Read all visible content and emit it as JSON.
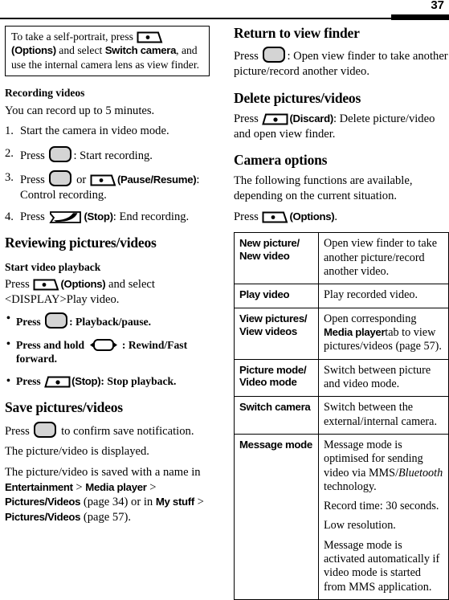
{
  "header": {
    "page_number": "37"
  },
  "left_column": {
    "note_box": {
      "text_1": "To take a self-portrait, press ",
      "key_options_label": "(Options)",
      "text_2": " and select ",
      "term_switch_camera": "Switch camera",
      "text_3": ", and use the internal camera lens as view finder."
    },
    "recording_videos": {
      "heading": "Recording videos",
      "intro": "You can record up to 5 minutes.",
      "steps": [
        {
          "num": "1.",
          "text_before": "Start the camera in video mode.",
          "keys": [],
          "text_after": ""
        },
        {
          "num": "2.",
          "text_before": "Press ",
          "key_center": "select-key",
          "text_after": ": Start recording."
        },
        {
          "num": "3.",
          "text_before": "Press ",
          "mid_text": " or ",
          "key_label": "(Pause/Resume)",
          "text_after": ": Control recording."
        },
        {
          "num": "4.",
          "text_before": "Press ",
          "key_label": "(Stop)",
          "text_after": ": End recording."
        }
      ]
    },
    "reviewing": {
      "heading": "Reviewing pictures/videos",
      "subheading": "Start video playback",
      "press_text": "Press ",
      "options_label": "(Options)",
      "press_text_2": " and select <DISPLAY>Play video.",
      "bullets": [
        {
          "text_before": "Press ",
          "key": "select-key",
          "text_after": ": Playback/pause."
        },
        {
          "text_before": "Press and hold ",
          "key": "nav-key",
          "text_after": " : Rewind/Fast forward."
        },
        {
          "text_before": "Press ",
          "key": "right-soft-key",
          "key_label": "(Stop)",
          "text_after": ": Stop playback."
        }
      ]
    },
    "save": {
      "heading": "Save pictures/videos",
      "line1_before": "Press ",
      "line1_after": " to confirm save notification.",
      "line2": "The picture/video is displayed.",
      "line3_a": "The picture/video is saved with a name in ",
      "line3_term1": "Entertainment",
      "line3_sep1": " > ",
      "line3_term2": "Media player",
      "line3_sep2": " > ",
      "line3_term3": "Pictures/Videos",
      "line3_b": " (page 34)  or in ",
      "line3_term4": "My stuff",
      "line3_sep3": " > ",
      "line3_term5": "Pictures/Videos",
      "line3_c": " (page 57)."
    }
  },
  "right_column": {
    "return_view_finder": {
      "heading": "Return to view finder",
      "text_before": "Press ",
      "text_after": ": Open view finder to take another picture/record another video."
    },
    "delete": {
      "heading": "Delete pictures/videos",
      "text_before": "Press ",
      "key_label": "(Discard)",
      "text_after": ": Delete picture/video and open view finder."
    },
    "camera_options": {
      "heading": "Camera options",
      "intro": "The following functions are available, depending on the current situation.",
      "press_before": "Press ",
      "press_label": "(Options)",
      "press_after": ".",
      "table": [
        {
          "option": "New picture/\nNew video",
          "description_parts": [
            {
              "text": "Open view finder to take another picture/record another video."
            }
          ]
        },
        {
          "option": "Play video",
          "description_parts": [
            {
              "text": "Play recorded video."
            }
          ]
        },
        {
          "option": "View pictures/\nView videos",
          "description_parts": [
            {
              "text": "Open corresponding "
            },
            {
              "text": "Media player",
              "style": "ui"
            },
            {
              "text": "tab to view pictures/videos (page 57)."
            }
          ]
        },
        {
          "option": "Picture mode/\nVideo mode",
          "description_parts": [
            {
              "text": "Switch between picture and video mode."
            }
          ]
        },
        {
          "option": "Switch camera",
          "description_parts": [
            {
              "text": "Switch between the external/internal camera."
            }
          ]
        },
        {
          "option": "Message mode",
          "description_parts": [
            {
              "text": "Message mode is optimised for sending video via MMS/"
            },
            {
              "text": "Bluetooth",
              "style": "italic"
            },
            {
              "text": " technology."
            }
          ],
          "extra_paragraphs": [
            "Record time: 30 seconds.",
            "Low resolution.",
            "Message mode is activated automatically if video mode is started from MMS application."
          ]
        }
      ]
    }
  },
  "icons": {
    "select_key": "select-key-icon",
    "nav_key": "navigation-key-icon",
    "left_soft_key": "left-soft-key-icon",
    "right_soft_key": "right-soft-key-icon",
    "end_key": "end-call-key-icon"
  }
}
